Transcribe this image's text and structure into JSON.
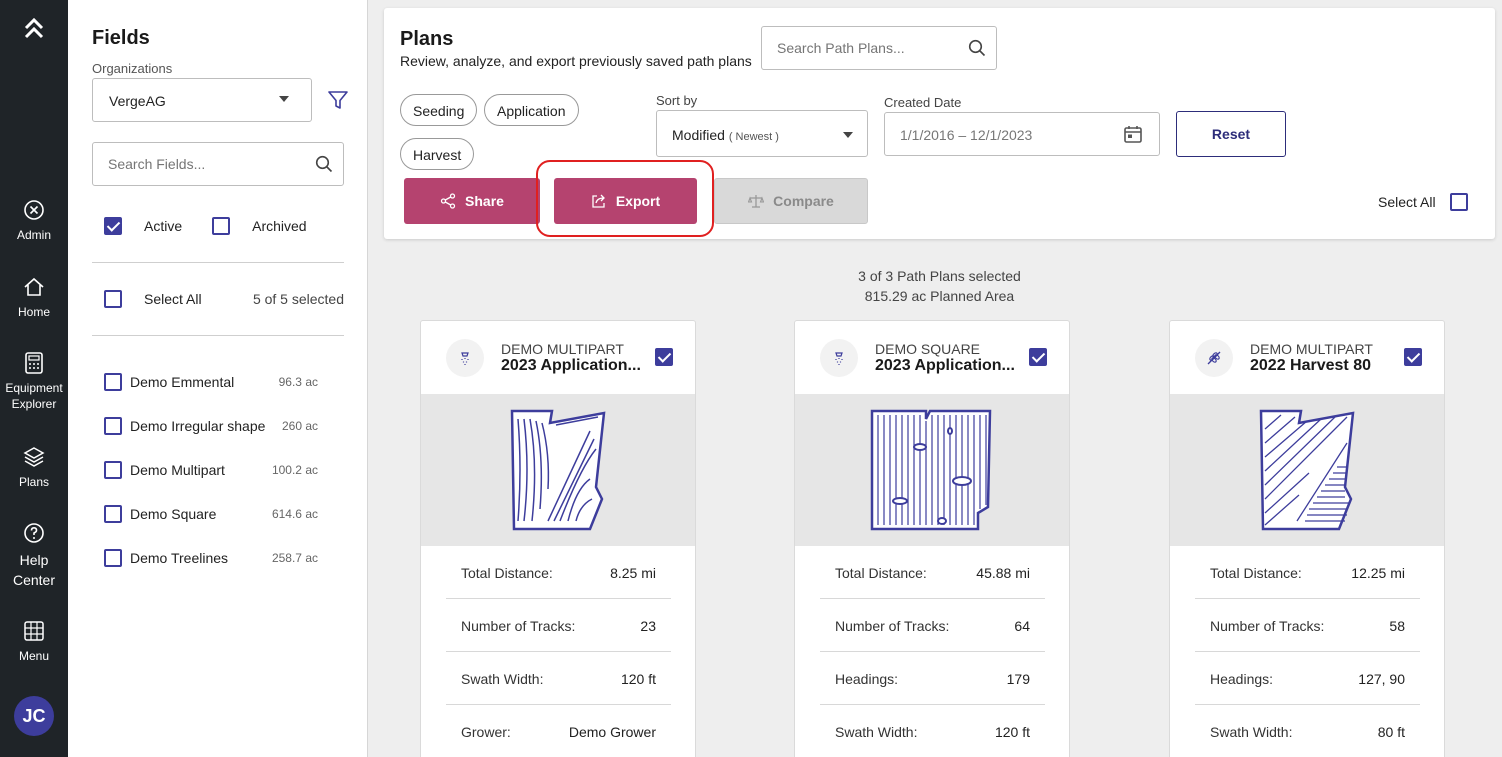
{
  "rail": {
    "items": [
      {
        "label": "Admin"
      },
      {
        "label": "Home"
      },
      {
        "label": "Equipment Explorer"
      },
      {
        "label": "Plans"
      },
      {
        "label": "Help Center"
      },
      {
        "label": "Menu"
      }
    ],
    "avatar_initials": "JC"
  },
  "fields_panel": {
    "title": "Fields",
    "org_label": "Organizations",
    "org_value": "VergeAG",
    "search_placeholder": "Search Fields...",
    "active_label": "Active",
    "archived_label": "Archived",
    "select_all_label": "Select All",
    "selected_count": "5 of 5 selected",
    "fields": [
      {
        "name": "Demo Emmental",
        "acres": "96.3 ac"
      },
      {
        "name": "Demo Irregular shape",
        "acres": "260 ac"
      },
      {
        "name": "Demo Multipart",
        "acres": "100.2 ac"
      },
      {
        "name": "Demo Square",
        "acres": "614.6 ac"
      },
      {
        "name": "Demo Treelines",
        "acres": "258.7 ac"
      }
    ]
  },
  "plans": {
    "title": "Plans",
    "subtitle": "Review, analyze, and export previously saved path plans",
    "search_placeholder": "Search Path Plans...",
    "chips": [
      "Seeding",
      "Application",
      "Harvest"
    ],
    "sort_label": "Sort by",
    "sort_value": "Modified",
    "sort_qualifier": "( Newest )",
    "date_label": "Created Date",
    "date_value": "1/1/2016 – 12/1/2023",
    "reset_label": "Reset",
    "share_label": "Share",
    "export_label": "Export",
    "compare_label": "Compare",
    "select_all_label": "Select All",
    "summary_line1": "3 of 3 Path Plans selected",
    "summary_line2": "815.29 ac Planned Area"
  },
  "cards": [
    {
      "field": "DEMO MULTIPART",
      "name": "2023 Application...",
      "stats": [
        {
          "k": "Total Distance:",
          "v": "8.25 mi"
        },
        {
          "k": "Number of Tracks:",
          "v": "23"
        },
        {
          "k": "Swath Width:",
          "v": "120 ft"
        },
        {
          "k": "Grower:",
          "v": "Demo Grower"
        }
      ]
    },
    {
      "field": "DEMO SQUARE",
      "name": "2023 Application...",
      "stats": [
        {
          "k": "Total Distance:",
          "v": "45.88 mi"
        },
        {
          "k": "Number of Tracks:",
          "v": "64"
        },
        {
          "k": "Headings:",
          "v": "179"
        },
        {
          "k": "Swath Width:",
          "v": "120 ft"
        }
      ]
    },
    {
      "field": "DEMO MULTIPART",
      "name": "2022 Harvest 80",
      "stats": [
        {
          "k": "Total Distance:",
          "v": "12.25 mi"
        },
        {
          "k": "Number of Tracks:",
          "v": "58"
        },
        {
          "k": "Headings:",
          "v": "127, 90"
        },
        {
          "k": "Swath Width:",
          "v": "80 ft"
        }
      ]
    }
  ],
  "colors": {
    "rail_bg": "#1f2428",
    "accent": "#3d3d9c",
    "action": "#b5436f",
    "highlight": "#e02020"
  }
}
